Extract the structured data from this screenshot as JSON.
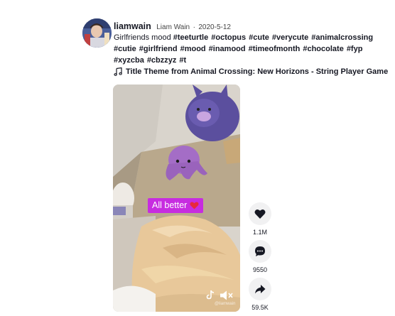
{
  "post": {
    "username": "liamwain",
    "nickname": "Liam Wain",
    "separator": "·",
    "date": "2020-5-12",
    "caption_text": "Girlfriends mood",
    "hashtags": [
      "#teeturtle",
      "#octopus",
      "#cute",
      "#verycute",
      "#animalcrossing",
      "#cutie",
      "#girlfriend",
      "#mood",
      "#inamood",
      "#timeofmonth",
      "#chocolate",
      "#fyp",
      "#xyzcba",
      "#cbzzyz",
      "#t"
    ],
    "music": "Title Theme from Animal Crossing: New Horizons - String Player Game"
  },
  "video": {
    "sticker_text": "All better",
    "watermark": "@liamwain"
  },
  "actions": {
    "likes": "1.1M",
    "comments": "9550",
    "shares": "59.5K"
  },
  "colors": {
    "sticker": "#c72ce0",
    "action_bg": "#f1f1f2",
    "text": "#161823"
  },
  "icons": [
    "avatar",
    "music-note-icon",
    "heart-icon",
    "comment-icon",
    "share-icon",
    "tiktok-logo-icon",
    "mute-icon"
  ]
}
